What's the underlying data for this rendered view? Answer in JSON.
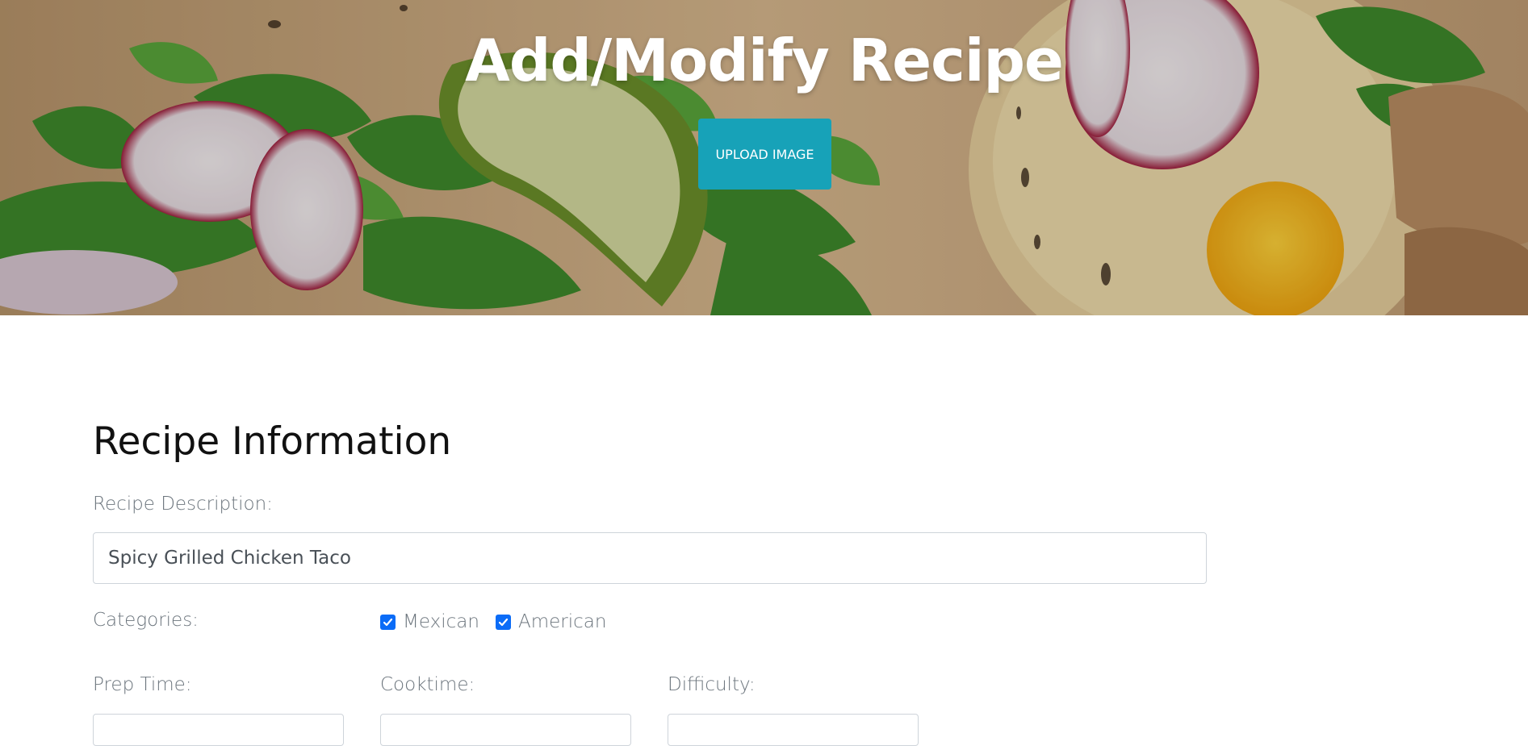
{
  "hero": {
    "title": "Add/Modify Recipe",
    "upload_label": "UPLOAD IMAGE",
    "button_color": "#17a2b8"
  },
  "form": {
    "section_title": "Recipe Information",
    "description": {
      "label": "Recipe Description:",
      "value": "Spicy Grilled Chicken Taco"
    },
    "categories": {
      "label": "Categories:",
      "options": [
        {
          "label": "Mexican",
          "checked": true
        },
        {
          "label": "American",
          "checked": true
        }
      ]
    },
    "prep_time": {
      "label": "Prep Time:"
    },
    "cook_time": {
      "label": "Cooktime:"
    },
    "difficulty": {
      "label": "Difficulty:"
    }
  }
}
